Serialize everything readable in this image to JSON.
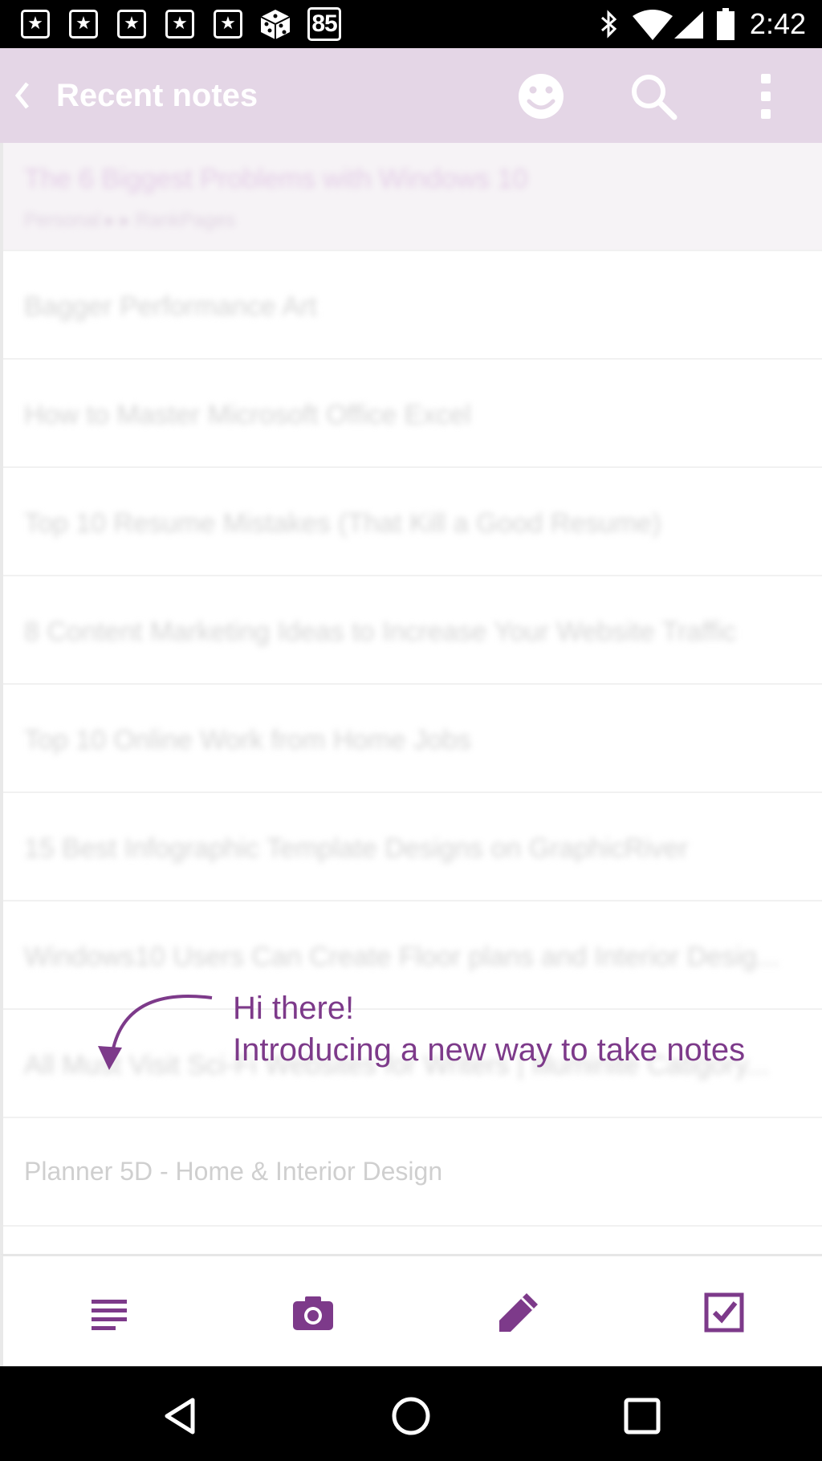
{
  "status_bar": {
    "badge_number": "85",
    "time": "2:42"
  },
  "header": {
    "title": "Recent notes"
  },
  "notes": [
    {
      "title": "The 6 Biggest Problems with Windows 10",
      "subtitle": "Personal ▸ ▸ RankPages"
    },
    {
      "title": "Bagger Performance Art"
    },
    {
      "title": "How to Master Microsoft Office Excel"
    },
    {
      "title": "Top 10 Resume Mistakes (That Kill a Good Resume)"
    },
    {
      "title": "8 Content Marketing Ideas to Increase Your Website Traffic"
    },
    {
      "title": "Top 10 Online Work from Home Jobs"
    },
    {
      "title": "15 Best Infographic Template Designs on GraphicRiver"
    },
    {
      "title": "Windows10 Users Can Create Floor plans and Interior Desig..."
    },
    {
      "title": "All Must Visit Sci-Fi Websites for Writers | Illuminite Catigory..."
    },
    {
      "title": "Planner 5D - Home & Interior Design"
    }
  ],
  "tip": {
    "line1": "Hi there!",
    "line2": "Introducing a new way to take notes"
  },
  "colors": {
    "accent": "#7d3a8a",
    "header_bg": "#e4d6e6"
  }
}
